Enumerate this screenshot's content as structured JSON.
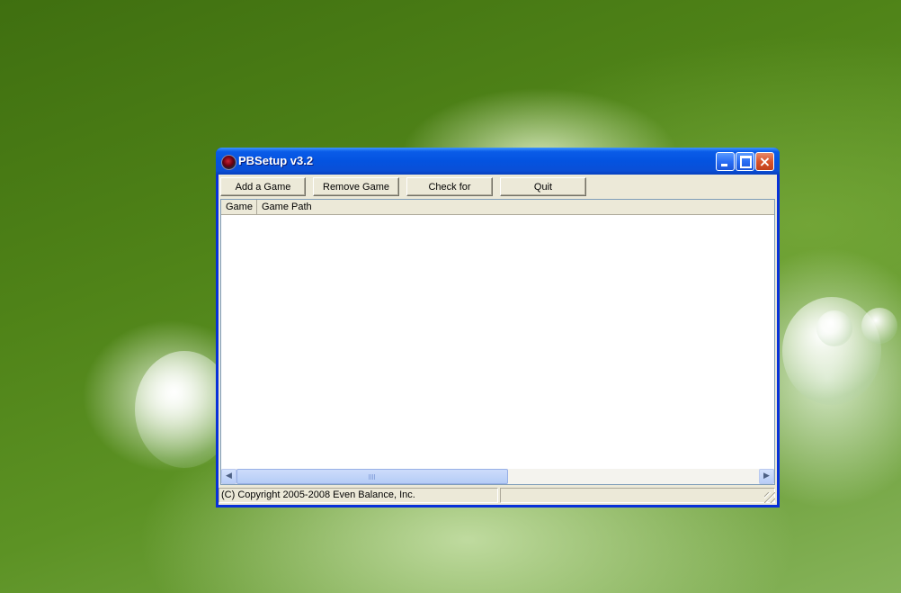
{
  "window": {
    "title": "PBSetup v3.2",
    "controls": {
      "minimize": "minimize",
      "maximize": "maximize",
      "close": "×"
    }
  },
  "toolbar": {
    "add_game": "Add a Game",
    "remove_game": "Remove Game",
    "check_updates": "Check for Updates",
    "quit": "Quit"
  },
  "list": {
    "columns": [
      "Game",
      "Game Path"
    ],
    "rows": []
  },
  "scrollbar": {
    "left_arrow": "◀",
    "right_arrow": "▶"
  },
  "status": {
    "copyright": "(C) Copyright 2005-2008 Even Balance, Inc.",
    "secondary": ""
  },
  "colors": {
    "title_bar": "#0453e0",
    "window_border": "#0831d9",
    "client_bg": "#ece9d8",
    "close_button": "#d9532b"
  },
  "icons": [
    "app-icon",
    "minimize-icon",
    "maximize-icon",
    "close-icon",
    "resize-grip-icon"
  ]
}
